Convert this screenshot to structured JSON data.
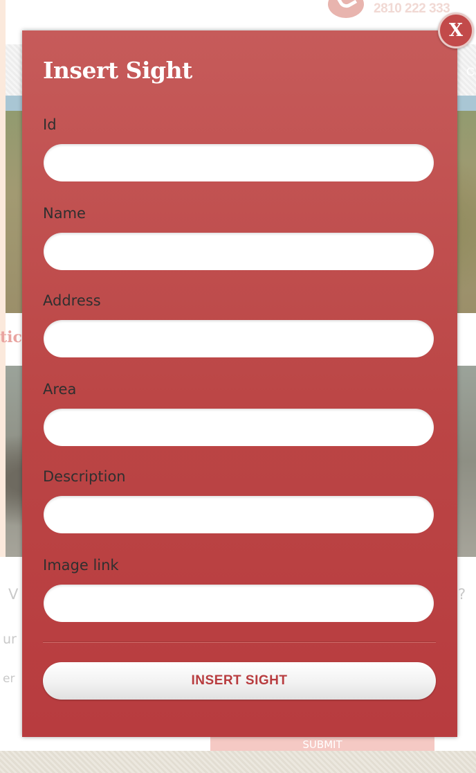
{
  "background": {
    "phone_number": "2810 222 333",
    "nav_fragment": "C",
    "band_fragment": "tic",
    "form_fragments": {
      "question_left": "V",
      "question_right": "?",
      "field1_left": "ur",
      "field2_left": "er",
      "submit_label": "SUBMIT"
    }
  },
  "modal": {
    "title": "Insert Sight",
    "close_label": "X",
    "fields": [
      {
        "label": "Id",
        "value": "",
        "placeholder": ""
      },
      {
        "label": "Name",
        "value": "",
        "placeholder": ""
      },
      {
        "label": "Address",
        "value": "",
        "placeholder": ""
      },
      {
        "label": "Area",
        "value": "",
        "placeholder": ""
      },
      {
        "label": "Description",
        "value": "",
        "placeholder": ""
      },
      {
        "label": "Image link",
        "value": "",
        "placeholder": ""
      }
    ],
    "submit_label": "INSERT SIGHT"
  },
  "colors": {
    "modal_red": "#bb4545",
    "page_background": "#fbe9dc",
    "button_text": "#b83c3f"
  }
}
